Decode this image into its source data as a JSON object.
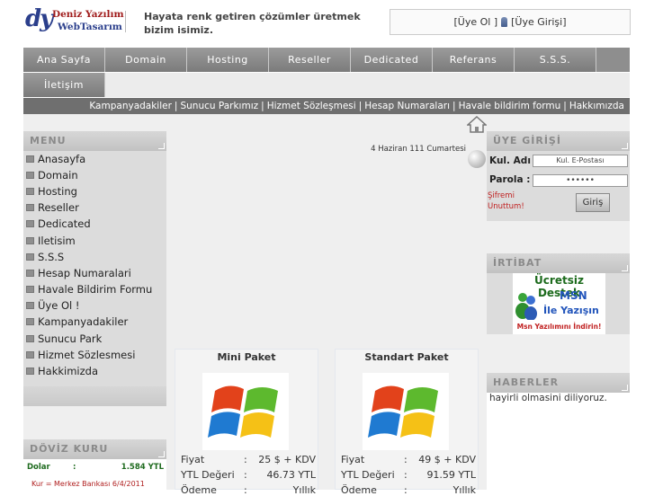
{
  "header": {
    "logo_mark": "dy",
    "logo_line1": "Deniz Yazılım",
    "logo_line2": "WebTasarım",
    "slogan": "Hayata renk getiren çözümler üretmek bizim isimiz.",
    "member_register": "[Üye Ol ]",
    "member_login": "[Üye Girişi]"
  },
  "nav": {
    "items": [
      "Ana Sayfa",
      "Domain",
      "Hosting",
      "Reseller",
      "Dedicated",
      "Referans",
      "S.S.S."
    ],
    "second_row": [
      "İletişim"
    ]
  },
  "sublinks": [
    "Kampanyadakiler",
    "Sunucu Parkımız",
    "Hizmet Sözleşmesi",
    "Hesap Numaraları",
    "Havale bildirim formu",
    "Hakkımızda"
  ],
  "menu": {
    "title": "MENU",
    "items": [
      "Anasayfa",
      "Domain",
      "Hosting",
      "Reseller",
      "Dedicated",
      "Iletisim",
      "S.S.S",
      "Hesap Numaralari",
      "Havale Bildirim Formu",
      "Üye Ol !",
      "Kampanyadakiler",
      "Sunucu Park",
      "Hizmet Sözlesmesi",
      "Hakkimizda"
    ]
  },
  "doviz": {
    "title": "DÖVİZ KURU",
    "label": "Dolar",
    "colon": ":",
    "value": "1.584 YTL",
    "note": "Kur = Merkez Bankası 6/4/2011"
  },
  "date_text": "4 Haziran 111 Cumartesi",
  "packages": [
    {
      "title": "Mini Paket",
      "rows": [
        {
          "k": "Fiyat",
          "v": "25 $ + KDV"
        },
        {
          "k": "YTL Değeri",
          "v": "46.73 YTL"
        },
        {
          "k": "Ödeme",
          "v": "Yıllık"
        }
      ]
    },
    {
      "title": "Standart Paket",
      "rows": [
        {
          "k": "Fiyat",
          "v": "49 $ + KDV"
        },
        {
          "k": "YTL Değeri",
          "v": "91.59 YTL"
        },
        {
          "k": "Ödeme",
          "v": "Yıllık"
        }
      ]
    }
  ],
  "login": {
    "title": "ÜYE GİRİŞİ",
    "user_label": "Kul. Adı :",
    "user_placeholder": "Kul. E-Postası",
    "pass_label": "Parola :",
    "pass_value": "••••••",
    "forgot": "Şifremi Unuttum!",
    "submit": "Giriş"
  },
  "irtibat": {
    "title": "İRTİBAT",
    "line1": "Ücretsiz Destek",
    "line2": "MSN",
    "line3": "İle Yazışın",
    "download": "Msn Yazılımını İndirin!"
  },
  "news": {
    "title": "HABERLER",
    "text": "hayirli olmasini diliyoruz."
  }
}
